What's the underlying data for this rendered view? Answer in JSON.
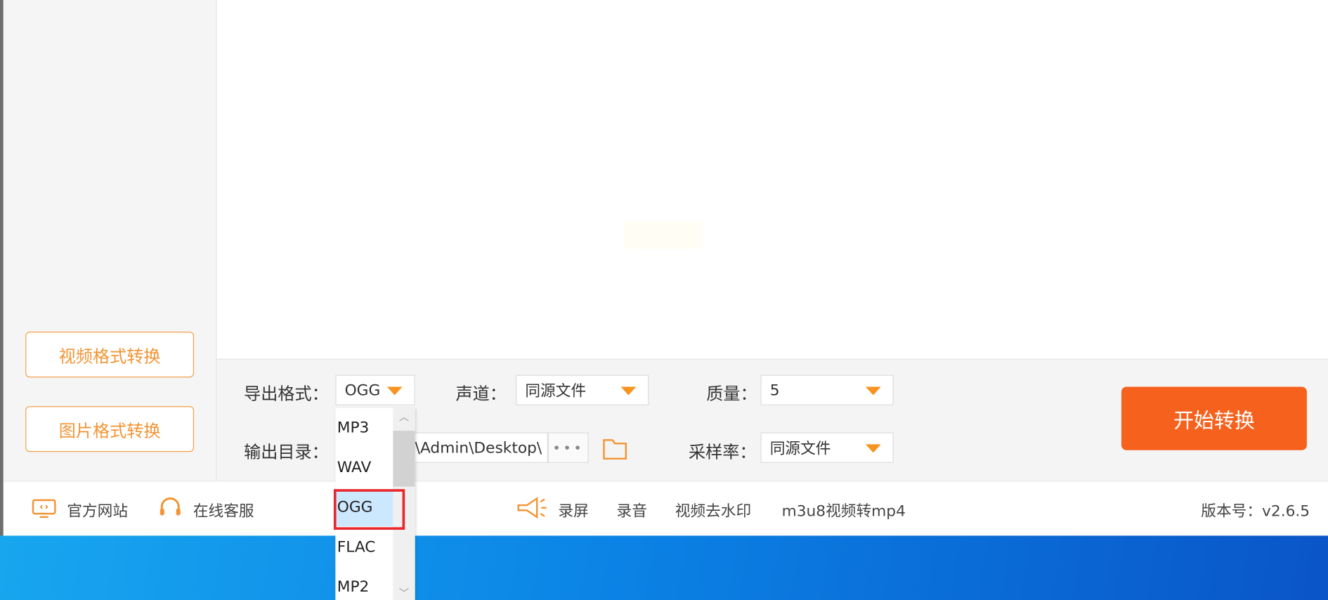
{
  "sidebar": {
    "video_convert": "视频格式转换",
    "image_convert": "图片格式转换"
  },
  "settings": {
    "export_format_label": "导出格式：",
    "export_format_value": "OGG",
    "channel_label": "声道：",
    "channel_value": "同源文件",
    "quality_label": "质量：",
    "quality_value": "5",
    "output_dir_label": "输出目录：",
    "output_dir_value": "\\Admin\\Desktop\\",
    "browse_label": "•••",
    "sample_rate_label": "采样率：",
    "sample_rate_value": "同源文件",
    "start_button": "开始转换"
  },
  "dropdown": {
    "options": [
      "MP3",
      "WAV",
      "OGG",
      "FLAC",
      "MP2"
    ],
    "selected": "OGG"
  },
  "statusbar": {
    "website": "官方网站",
    "support": "在线客服",
    "record_screen": "录屏",
    "record_audio": "录音",
    "remove_watermark": "视频去水印",
    "m3u8": "m3u8视频转mp4",
    "version": "版本号：v2.6.5"
  },
  "colors": {
    "accent": "#f6621e",
    "accent_light": "#f39434",
    "triangle": "#f7931e",
    "highlight": "#e8262c"
  }
}
